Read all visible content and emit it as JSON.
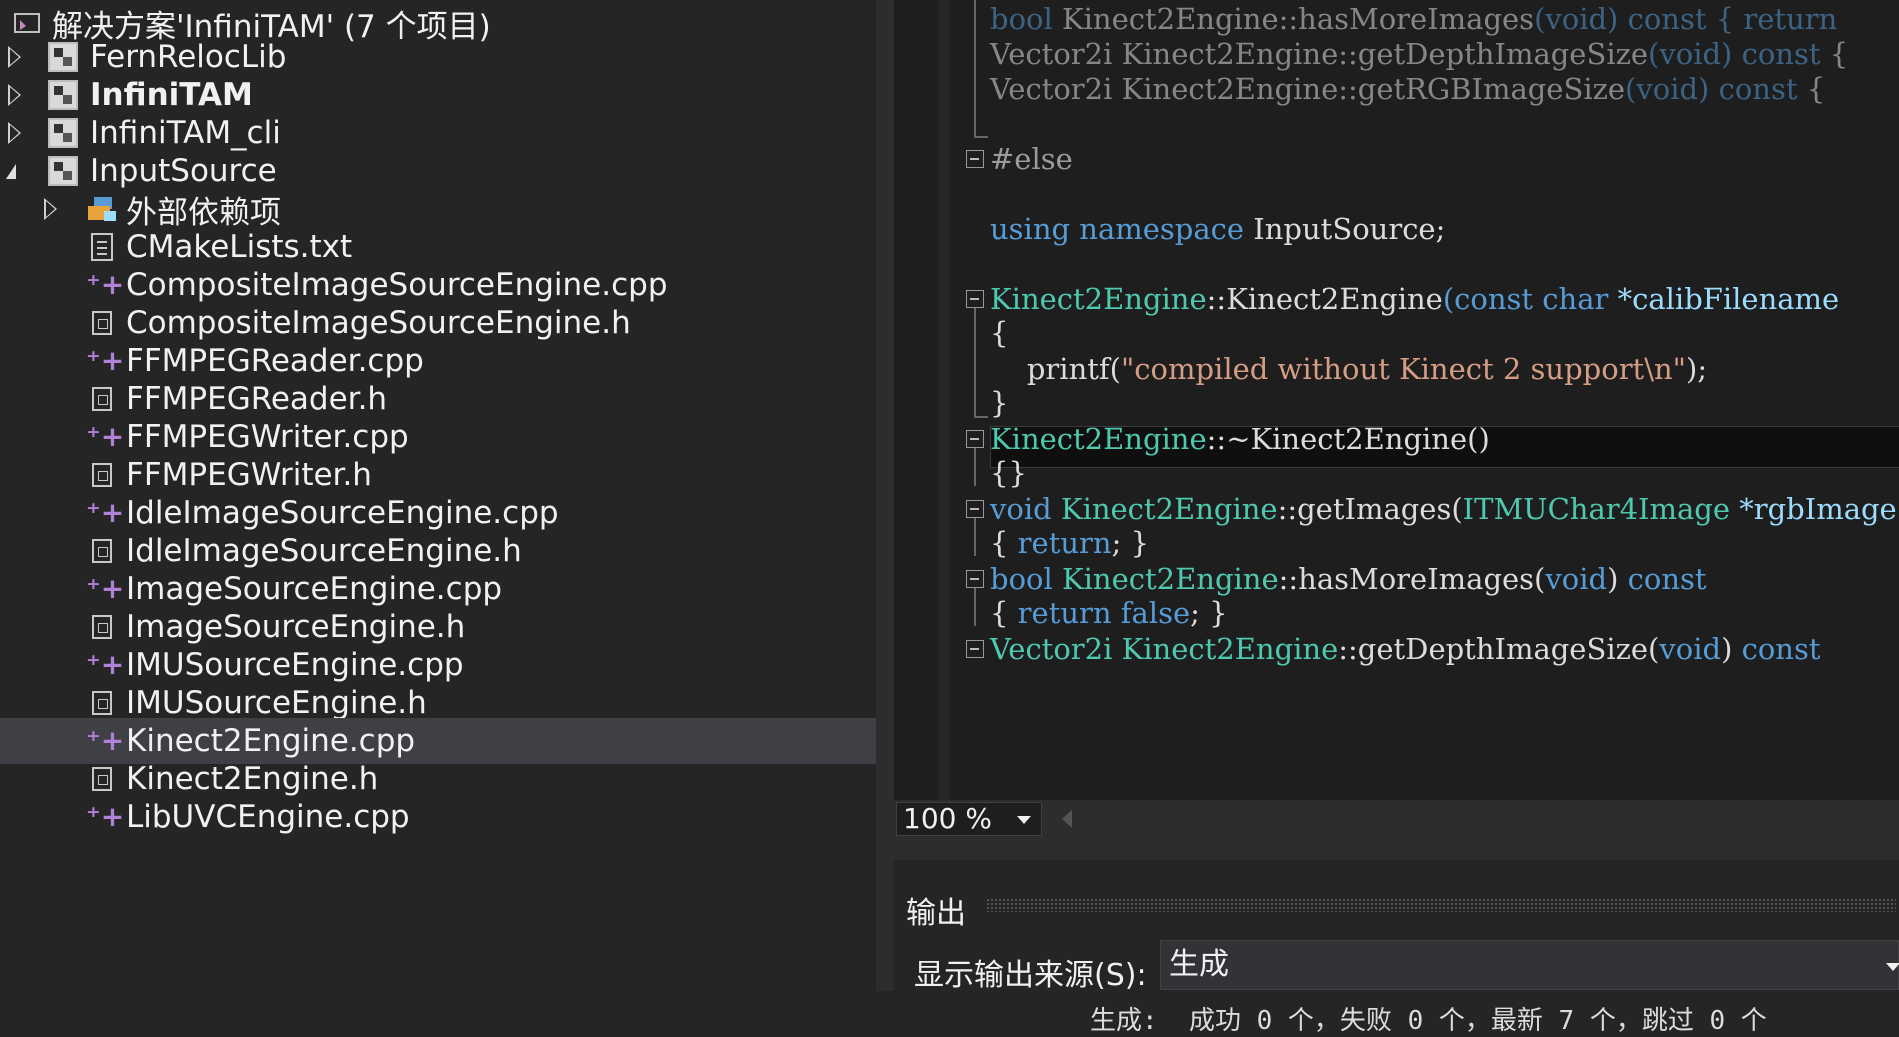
{
  "solution": {
    "title": "解决方案'InfiniTAM' (7 个项目)",
    "projects": [
      {
        "label": "FernRelocLib"
      },
      {
        "label": "InfiniTAM"
      },
      {
        "label": "InfiniTAM_cli"
      },
      {
        "label": "InputSource"
      }
    ],
    "input_source_children": {
      "dependencies_label": "外部依赖项",
      "files": [
        {
          "label": "CMakeLists.txt",
          "icon": "text-file-icon"
        },
        {
          "label": "CompositeImageSourceEngine.cpp",
          "icon": "cpp-file-icon"
        },
        {
          "label": "CompositeImageSourceEngine.h",
          "icon": "header-file-icon"
        },
        {
          "label": "FFMPEGReader.cpp",
          "icon": "cpp-file-icon"
        },
        {
          "label": "FFMPEGReader.h",
          "icon": "header-file-icon"
        },
        {
          "label": "FFMPEGWriter.cpp",
          "icon": "cpp-file-icon"
        },
        {
          "label": "FFMPEGWriter.h",
          "icon": "header-file-icon"
        },
        {
          "label": "IdleImageSourceEngine.cpp",
          "icon": "cpp-file-icon"
        },
        {
          "label": "IdleImageSourceEngine.h",
          "icon": "header-file-icon"
        },
        {
          "label": "ImageSourceEngine.cpp",
          "icon": "cpp-file-icon"
        },
        {
          "label": "ImageSourceEngine.h",
          "icon": "header-file-icon"
        },
        {
          "label": "IMUSourceEngine.cpp",
          "icon": "cpp-file-icon"
        },
        {
          "label": "IMUSourceEngine.h",
          "icon": "header-file-icon"
        },
        {
          "label": "Kinect2Engine.cpp",
          "icon": "cpp-file-icon"
        },
        {
          "label": "Kinect2Engine.h",
          "icon": "header-file-icon"
        },
        {
          "label": "LibUVCEngine.cpp",
          "icon": "cpp-file-icon"
        }
      ]
    }
  },
  "editor": {
    "lines": [
      {
        "t1": "bool",
        "t2": " Kinect2Engine::hasMoreImages",
        "t3": "(void)",
        "t4": " const",
        "t5": " { return"
      },
      {
        "t1": "Vector2i",
        "t2": " Kinect2Engine::getDepthImageSize",
        "t3": "(void)",
        "t4": " const",
        "t5": " {"
      },
      {
        "t1": "Vector2i",
        "t2": " Kinect2Engine::getRGBImageSize",
        "t3": "(void)",
        "t4": " const",
        "t5": " {"
      },
      {
        "pp": "#else"
      },
      {
        "kw1": "using",
        "kw2": " namespace",
        "rest": " InputSource;"
      },
      {
        "ty": "Kinect2Engine",
        "rest": "::Kinect2Engine",
        "kw1": "(const",
        "kw2": " char",
        "par": " *calibFilename"
      },
      {
        "rest": "{"
      },
      {
        "fn": "    printf(",
        "str": "\"compiled without Kinect 2 support\\n\"",
        "rest": ");"
      },
      {
        "rest": "}"
      },
      {
        "ty": "Kinect2Engine",
        "rest": "::~Kinect2Engine()"
      },
      {
        "rest": "{}"
      },
      {
        "kw": "void",
        "ty": " Kinect2Engine",
        "rest": "::getImages(",
        "ty2": "ITMUChar4Image",
        "par": " *rgbImage"
      },
      {
        "rest": "{ ",
        "kw": "return",
        "rest2": "; }"
      },
      {
        "kw": "bool",
        "ty": " Kinect2Engine",
        "rest": "::hasMoreImages(",
        "kw2": "void",
        "rest2": ") ",
        "kw3": "const"
      },
      {
        "rest": "{ ",
        "kw": "return false",
        "rest2": "; }"
      },
      {
        "ty": "Vector2i",
        "ty2": " Kinect2Engine",
        "rest": "::getDepthImageSize(",
        "kw": "void",
        "rest2": ") ",
        "kw2": "const"
      }
    ]
  },
  "zoom": {
    "value": "100 %"
  },
  "output": {
    "title": "输出",
    "source_label": "显示输出来源(S):",
    "source_value": "生成",
    "summary": "生成:  成功 0 个，失败 0 个，最新 7 个，跳过 0 个"
  }
}
